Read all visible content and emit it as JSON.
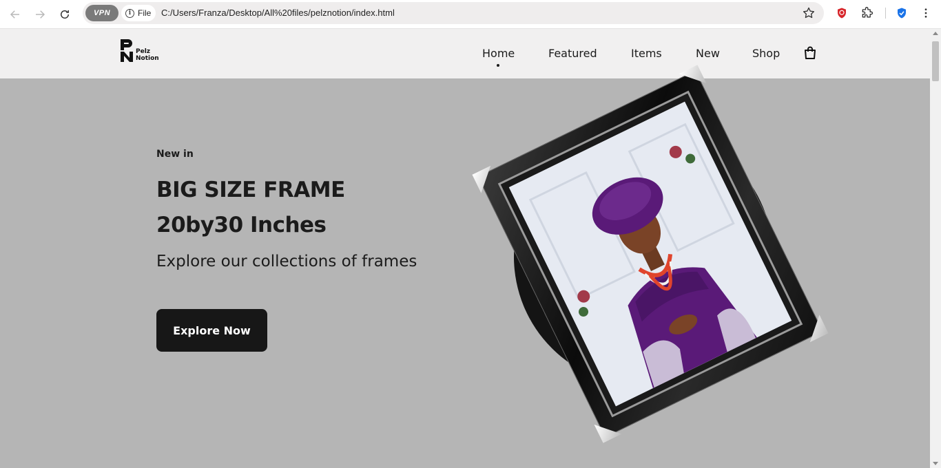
{
  "browser": {
    "vpn_label": "VPN",
    "file_chip": "File",
    "url": "C:/Users/Franza/Desktop/All%20files/pelznotion/index.html",
    "icons": [
      "back-arrow-icon",
      "forward-arrow-icon",
      "reload-icon",
      "info-icon",
      "star-icon",
      "adblock-shield-icon",
      "extensions-puzzle-icon",
      "security-shield-icon",
      "kebab-menu-icon"
    ]
  },
  "site": {
    "logo": {
      "line1": "Pelz",
      "line2": "Notion"
    },
    "nav": [
      {
        "label": "Home",
        "active": true
      },
      {
        "label": "Featured"
      },
      {
        "label": "Items"
      },
      {
        "label": "New"
      },
      {
        "label": "Shop"
      }
    ],
    "cart_icon": "shopping-bag-icon"
  },
  "hero": {
    "kicker": "New in",
    "title": "BIG SIZE FRAME",
    "subtitle": "20by30 Inches",
    "description": "Explore our collections of frames",
    "cta_label": "Explore Now",
    "image_alt": "Framed portrait of woman in purple gele and dress"
  },
  "colors": {
    "header_bg": "#f1f0f0",
    "hero_bg": "#b5b5b5",
    "button_bg": "#171717",
    "text": "#1b1b1b",
    "accent_purple": "#5a1a78"
  }
}
